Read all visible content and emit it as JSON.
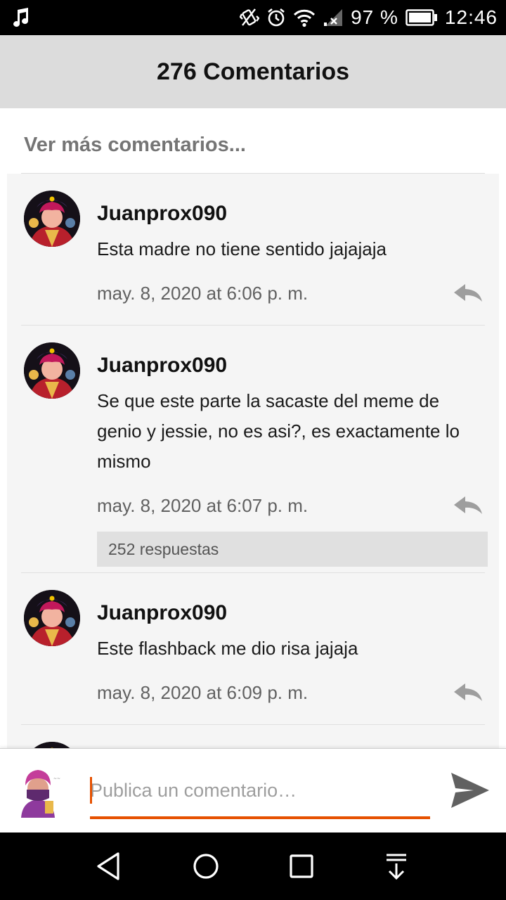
{
  "status_bar": {
    "battery": "97 %",
    "time": "12:46",
    "icons": [
      "music-note-icon",
      "vibrate-icon",
      "alarm-icon",
      "wifi-icon",
      "signal-icon",
      "battery-icon"
    ]
  },
  "header": {
    "title": "276 Comentarios"
  },
  "more_comments": {
    "label": "Ver más comentarios..."
  },
  "comments": [
    {
      "author": "Juanprox090",
      "text": "Esta madre no tiene sentido jajajaja",
      "date": "may. 8, 2020 at 6:06 p. m.",
      "replies": ""
    },
    {
      "author": "Juanprox090",
      "text": "Se que este parte la sacaste del meme de genio y jessie, no es asi?, es exactamente lo mismo",
      "date": "may. 8, 2020 at 6:07 p. m.",
      "replies": "252 respuestas"
    },
    {
      "author": "Juanprox090",
      "text": "Este flashback me dio risa jajaja",
      "date": "may. 8, 2020 at 6:09 p. m.",
      "replies": ""
    }
  ],
  "composer": {
    "placeholder": "Publica un comentario…",
    "value": ""
  },
  "colors": {
    "accent": "#e65100",
    "header_bg": "#dcdcdc",
    "list_bg": "#f5f5f5",
    "date": "#616161"
  },
  "nav": {
    "icons": [
      "back-icon",
      "home-icon",
      "recents-icon",
      "notification-pull-icon"
    ]
  }
}
